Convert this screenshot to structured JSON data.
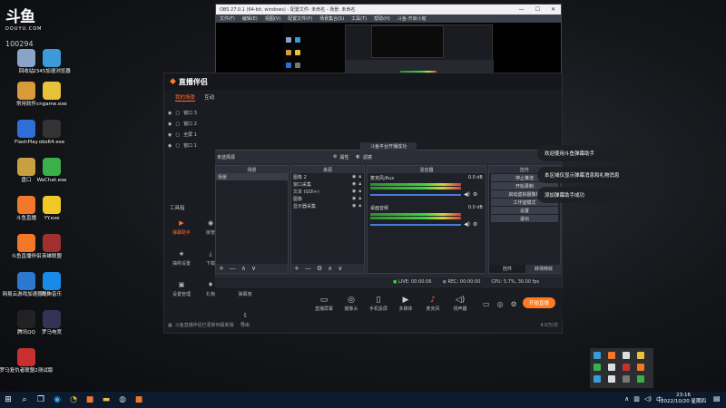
{
  "desktop": {
    "logo_big": "斗鱼",
    "logo_small": "DOUYU.COM",
    "room_id": "100294",
    "icons": [
      {
        "label": "回收站",
        "icon": "recycle-bin-icon",
        "color": "#8aa4c8"
      },
      {
        "label": "2345加速浏览器",
        "icon": "browser-icon",
        "color": "#3a9bd8"
      },
      {
        "label": "常用软件",
        "icon": "folder-icon",
        "color": "#d89a3a"
      },
      {
        "label": "cngame.exe",
        "icon": "pacman-icon",
        "color": "#e8c23a"
      },
      {
        "label": "FlashPlay",
        "icon": "flash-icon",
        "color": "#2e6fd8"
      },
      {
        "label": "obs64.exe",
        "icon": "obs-icon",
        "color": "#333"
      },
      {
        "label": "盘口",
        "icon": "folder-icon",
        "color": "#c8a040"
      },
      {
        "label": "WeChat.exe",
        "icon": "wechat-icon",
        "color": "#3ab04a"
      },
      {
        "label": "斗鱼直播",
        "icon": "douyu-icon",
        "color": "#f07828"
      },
      {
        "label": "YY.exe",
        "icon": "yy-icon",
        "color": "#f0c828"
      },
      {
        "label": "斗鱼直播伴侣",
        "icon": "douyu-icon",
        "color": "#f07828"
      },
      {
        "label": "英雄联盟",
        "icon": "lol-icon",
        "color": "#a03030"
      },
      {
        "label": "网易云游戏加速器5.0",
        "icon": "accelerator-icon",
        "color": "#2a78d0"
      },
      {
        "label": "酷狗音乐",
        "icon": "kugou-icon",
        "color": "#1a8ae8"
      },
      {
        "label": "腾讯QQ",
        "icon": "qq-icon",
        "color": "#222"
      },
      {
        "label": "罗马电竞",
        "icon": "shield-icon",
        "color": "#335"
      },
      {
        "label": "罗马复仇者联盟2测试版",
        "icon": "game-icon",
        "color": "#c83030"
      }
    ]
  },
  "obs": {
    "title": "OBS 27.0.1 (64-bit, windows) - 配置文件: 未命名 - 场景: 未命名",
    "menu": [
      "文件(F)",
      "编辑(E)",
      "视图(V)",
      "配置文件(P)",
      "场景集合(S)",
      "工具(T)",
      "帮助(H)",
      "斗鱼-开启小窗"
    ],
    "status_toast": "斗鱼平台开播成功",
    "scenes_label": "场景",
    "sources_label": "来源",
    "mixer_label": "混音器",
    "controls_label": "控件",
    "source_tab_left": "未选择源",
    "props_btn": "属性",
    "filter_btn": "滤镜",
    "scene_list": [
      "场景"
    ],
    "sources": [
      "图像 2",
      "窗口采集",
      "文本 (GDI+)",
      "图像",
      "显示器采集"
    ],
    "mixer_tracks": [
      {
        "name": "麦克风/Aux",
        "db": "0.0 dB"
      },
      {
        "name": "桌面音频",
        "db": "0.0 dB"
      }
    ],
    "controls": [
      "停止推流",
      "开始录制",
      "启动虚拟摄像机",
      "工作室模式",
      "设置",
      "退出"
    ],
    "controls_tabs": [
      "控件",
      "转场特效"
    ],
    "status_bar": {
      "live": "LIVE: 00:00:06",
      "rec": "REC: 00:00:00",
      "cpu": "CPU: 5.7%, 30.00 fps"
    }
  },
  "zhibo": {
    "brand": "直播伴侣",
    "tabs": [
      "我的场景",
      "互动"
    ],
    "scenes": [
      "窗口 3",
      "窗口 2",
      "全屏 1",
      "窗口 1"
    ],
    "tools_label": "工具箱",
    "tools": [
      {
        "label": "弹幕助手",
        "color": "#ff6f2a"
      },
      {
        "label": "房管"
      },
      {
        "label": "抽奖设置"
      },
      {
        "label": "下载"
      },
      {
        "label": "设置管理"
      },
      {
        "label": "礼物"
      },
      {
        "label": "弹幕墙"
      },
      {
        "label": "导出"
      }
    ],
    "footer_text": "斗鱼直播伴侣已更新到最新版",
    "bottom_tools": [
      "直播屏幕",
      "摄像头",
      "手机投屏",
      "多媒体",
      "麦克风",
      "扬声器"
    ],
    "start_button": "开始直播",
    "volume_right": "4.0万/次"
  },
  "notifications": [
    "欢迎使用斗鱼弹幕助手",
    "本区域仅显示弹幕消息和礼物消息",
    "添加弹幕助手成功"
  ],
  "taskbar": {
    "time": "23:16",
    "date": "2022/10/20 星期四"
  }
}
